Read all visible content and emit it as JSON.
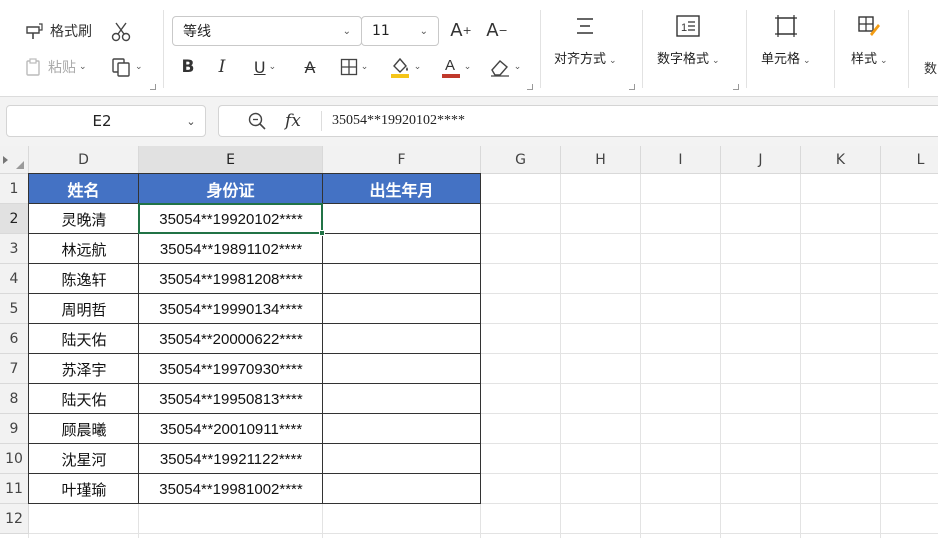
{
  "ribbon": {
    "format_painter": "格式刷",
    "paste": "粘贴",
    "font_name": "等线",
    "font_size": "11",
    "align": "对齐方式",
    "number_format": "数字格式",
    "cells": "单元格",
    "styles": "样式",
    "cutoff": "数"
  },
  "formula_bar": {
    "name_box": "E2",
    "fx": "fx",
    "value": "35054**19920102****"
  },
  "columns": [
    "D",
    "E",
    "F",
    "G",
    "H",
    "I",
    "J",
    "K",
    "L"
  ],
  "rows": [
    "1",
    "2",
    "3",
    "4",
    "5",
    "6",
    "7",
    "8",
    "9",
    "10",
    "11",
    "12"
  ],
  "table": {
    "headers": [
      "姓名",
      "身份证",
      "出生年月"
    ],
    "names": [
      "灵晚清",
      "林远航",
      "陈逸轩",
      "周明哲",
      "陆天佑",
      "苏泽宇",
      "陆天佑",
      "顾晨曦",
      "沈星河",
      "叶瑾瑜"
    ],
    "ids": [
      "35054**19920102****",
      "35054**19891102****",
      "35054**19981208****",
      "35054**19990134****",
      "35054**20000622****",
      "35054**19970930****",
      "35054**19950813****",
      "35054**20010911****",
      "35054**19921122****",
      "35054**19981002****"
    ],
    "header_color": "#4472c4"
  },
  "selection": {
    "cell": "E2",
    "color": "#217346"
  }
}
